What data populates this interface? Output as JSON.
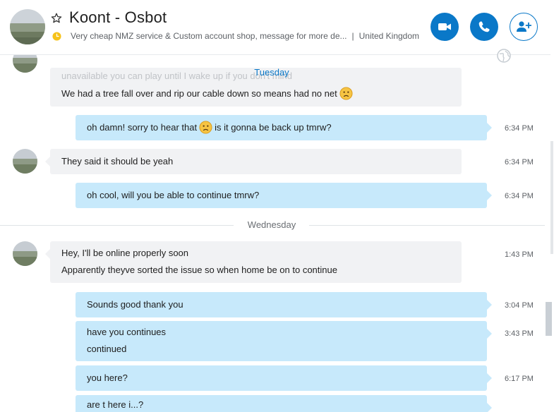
{
  "header": {
    "title": "Koont - Osbot",
    "mood": "Very cheap NMZ service & Custom account shop, message for more de...",
    "separator": "|",
    "location": "United Kingdom"
  },
  "day_separators": {
    "tuesday": "Tuesday",
    "wednesday": "Wednesday"
  },
  "messages": {
    "m0_ghost": "unavailable you can play until I wake up if you don't mind",
    "m0_text": "We had a tree fall over and rip our cable down so means had no net",
    "m1_text_a": "oh damn! sorry to hear that",
    "m1_text_b": "is it gonna be back up tmrw?",
    "m1_time": "6:34 PM",
    "m2_text": "They said it should be yeah",
    "m2_time": "6:34 PM",
    "m3_text": "oh cool, will you be able to continue tmrw?",
    "m3_time": "6:34 PM",
    "m4_line1": "Hey, I'll be online properly soon",
    "m4_line2": "Apparently theyve sorted the issue so when home be on to continue",
    "m4_time": "1:43 PM",
    "m5_text": "Sounds good thank you",
    "m5_time": "3:04 PM",
    "m6_line1": "have you continues",
    "m6_line2": "continued",
    "m6_time": "3:43 PM",
    "m7_text": "you here?",
    "m7_time": "6:17 PM",
    "m8_partial": "are t here i...?"
  },
  "colors": {
    "accent": "#0a78c8",
    "outgoing_bubble": "#c7e9fb",
    "incoming_bubble": "#f1f2f4",
    "day_label": "#0a78c8"
  },
  "icons": [
    "star-icon",
    "clock-icon",
    "video-call-icon",
    "phone-icon",
    "add-person-icon",
    "globe-icon",
    "sad-emoji-icon"
  ]
}
